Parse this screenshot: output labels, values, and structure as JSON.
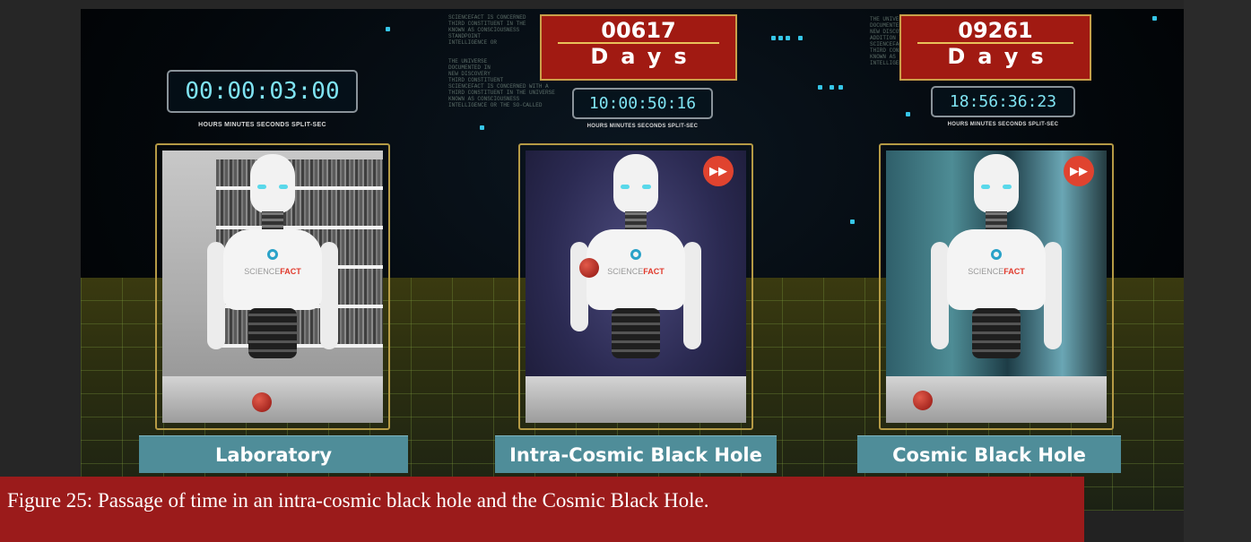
{
  "timers": [
    {
      "value": "00:00:03:00",
      "caption": "HOURS    MINUTES    SECONDS   SPLIT-SEC"
    },
    {
      "value": "10:00:50:16",
      "caption": "HOURS   MINUTES   SECONDS  SPLIT-SEC"
    },
    {
      "value": "18:56:36:23",
      "caption": "HOURS   MINUTES   SECONDS  SPLIT-SEC"
    }
  ],
  "days_counters": [
    {
      "number": "00617",
      "unit": "Days"
    },
    {
      "number": "09261",
      "unit": "Days"
    }
  ],
  "panels": [
    {
      "label": "Laboratory",
      "brand_prefix": "SCIENCE",
      "brand_suffix": "FACT"
    },
    {
      "label": "Intra-Cosmic Black Hole",
      "brand_prefix": "SCIENCE",
      "brand_suffix": "FACT"
    },
    {
      "label": "Cosmic Black Hole",
      "brand_prefix": "SCIENCE",
      "brand_suffix": "FACT"
    }
  ],
  "icons": {
    "fast_forward": "fast-forward-icon"
  },
  "colors": {
    "caption_bg": "#9b1b1b",
    "days_box": "#a11a12",
    "timer_digits": "#7fe3f2",
    "label_bar": "#4f8d99",
    "accent_dots": "#36c6e8"
  },
  "caption": "Figure 25: Passage of time in an intra-cosmic black hole and the Cosmic Black Hole."
}
